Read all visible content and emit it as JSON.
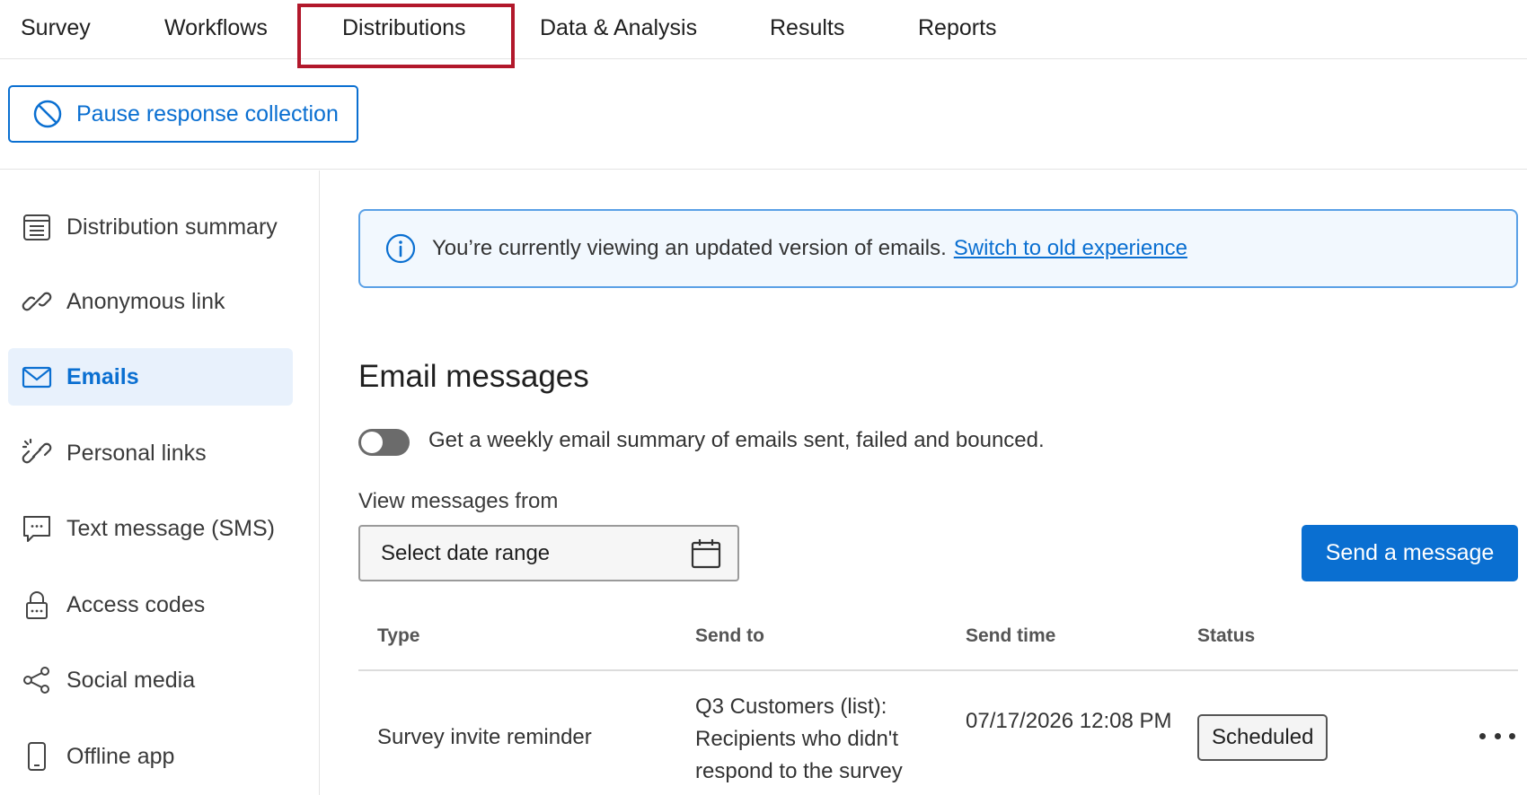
{
  "top_tabs": [
    {
      "label": "Survey"
    },
    {
      "label": "Workflows"
    },
    {
      "label": "Distributions",
      "active": true
    },
    {
      "label": "Data & Analysis"
    },
    {
      "label": "Results"
    },
    {
      "label": "Reports"
    }
  ],
  "toolbar": {
    "pause_label": "Pause response collection",
    "pause_icon": "prohibited-icon"
  },
  "sidebar": {
    "items": [
      {
        "label": "Distribution summary",
        "icon": "summary-list-icon"
      },
      {
        "label": "Anonymous link",
        "icon": "link-icon"
      },
      {
        "label": "Emails",
        "icon": "envelope-icon",
        "active": true
      },
      {
        "label": "Personal links",
        "icon": "broken-link-icon"
      },
      {
        "label": "Text message (SMS)",
        "icon": "chat-bubble-icon"
      },
      {
        "label": "Access codes",
        "icon": "lock-icon"
      },
      {
        "label": "Social media",
        "icon": "share-icon"
      },
      {
        "label": "Offline app",
        "icon": "phone-icon"
      }
    ]
  },
  "banner": {
    "message": "You’re currently viewing an updated version of emails.",
    "link_text": "Switch to old experience",
    "icon": "info-icon"
  },
  "main": {
    "title": "Email messages",
    "weekly_summary_label": "Get a weekly email summary of emails sent, failed and bounced.",
    "weekly_summary_enabled": false,
    "view_from_label": "View messages from",
    "date_range_placeholder": "Select date range",
    "send_button": "Send a message"
  },
  "table": {
    "headers": {
      "type": "Type",
      "send_to": "Send to",
      "send_time": "Send time",
      "status": "Status"
    },
    "rows": [
      {
        "type": "Survey invite reminder",
        "send_to": "Q3 Customers (list): Recipients who didn't respond to the survey",
        "send_time": "07/17/2026 12:08 PM",
        "status": "Scheduled"
      }
    ]
  },
  "colors": {
    "accent": "#0a6fd1",
    "active_tab_outline": "#b2182b",
    "banner_border": "#5aa0e6",
    "banner_background": "#f2f8fe",
    "active_side_background": "#e8f1fc"
  }
}
